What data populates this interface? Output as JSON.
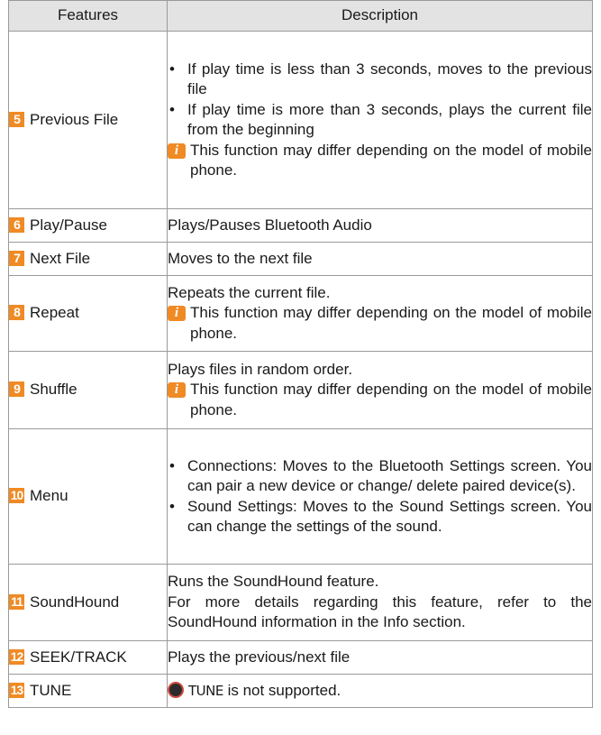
{
  "header": {
    "features": "Features",
    "description": "Description"
  },
  "rows": [
    {
      "num": "5",
      "feature": "Previous File",
      "bullets": [
        "If play time is less than 3 seconds, moves to the previous file",
        "If play time is more than 3 seconds, plays the current file from the beginning"
      ],
      "note": "This function may differ depending on the model of mobile phone."
    },
    {
      "num": "6",
      "feature": "Play/Pause",
      "text": "Plays/Pauses Bluetooth Audio"
    },
    {
      "num": "7",
      "feature": "Next File",
      "text": "Moves to the next file"
    },
    {
      "num": "8",
      "feature": "Repeat",
      "text": "Repeats the current file.",
      "note": "This function may differ depending on the model of mobile phone."
    },
    {
      "num": "9",
      "feature": "Shuffle",
      "text": "Plays files in random order.",
      "note": "This function may differ depending on the model of mobile phone."
    },
    {
      "num": "10",
      "feature": "Menu",
      "bullets": [
        "Connections: Moves to the Bluetooth Settings screen. You can pair a new device or change/ delete paired device(s).",
        "Sound Settings: Moves to the Sound Settings screen. You can change the settings of the sound."
      ]
    },
    {
      "num": "11",
      "feature": "SoundHound",
      "lines": [
        "Runs the SoundHound feature.",
        "For more details regarding this feature, refer to the SoundHound information in the Info section."
      ]
    },
    {
      "num": "12",
      "feature": "SEEK/TRACK",
      "text": "Plays the previous/next file"
    },
    {
      "num": "13",
      "feature": "TUNE",
      "tune_word": "TUNE",
      "text": "is not supported."
    }
  ],
  "bullet_char": "•",
  "info_icon_char": "i",
  "colors": {
    "number_badge": "#f08a24",
    "header_bg": "#e3e3e3",
    "border": "#9a9a9a"
  }
}
